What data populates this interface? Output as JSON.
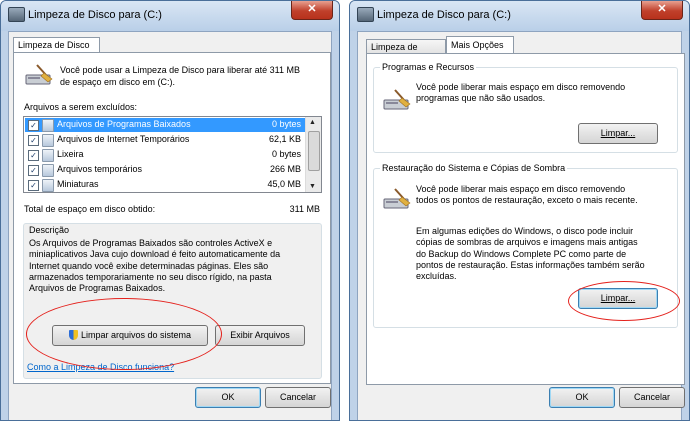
{
  "left": {
    "title": "Limpeza de Disco para  (C:)",
    "close_glyph": "✕",
    "tab": "Limpeza de Disco",
    "intro_line1": "Você pode usar a Limpeza de Disco para liberar até 311 MB",
    "intro_line2": "de espaço em disco em  (C:).",
    "list_label": "Arquivos a serem excluídos:",
    "files": [
      {
        "name": "Arquivos de Programas Baixados",
        "size": "0 bytes",
        "checked": true,
        "selected": true
      },
      {
        "name": "Arquivos de Internet Temporários",
        "size": "62,1 KB",
        "checked": true,
        "selected": false
      },
      {
        "name": "Lixeira",
        "size": "0 bytes",
        "checked": true,
        "selected": false
      },
      {
        "name": "Arquivos temporários",
        "size": "266 MB",
        "checked": true,
        "selected": false
      },
      {
        "name": "Miniaturas",
        "size": "45,0 MB",
        "checked": true,
        "selected": false
      }
    ],
    "total_label": "Total de espaço em disco obtido:",
    "total_value": "311 MB",
    "desc_label": "Descrição",
    "desc_text": "Os Arquivos de Programas Baixados são controles ActiveX e\nminiaplicativos Java cujo download é feito automaticamente da\nInternet quando você exibe determinadas páginas. Eles são\narmazenados temporariamente no seu disco rígido, na pasta\nArquivos de Programas Baixados.",
    "clean_system_button": "Limpar arquivos do sistema",
    "view_files_button": "Exibir Arquivos",
    "help_link": "Como a Limpeza de Disco funciona?",
    "ok_button": "OK",
    "cancel_button": "Cancelar"
  },
  "right": {
    "title": "Limpeza de Disco para  (C:)",
    "close_glyph": "✕",
    "tab1": "Limpeza de Disco",
    "tab2": "Mais Opções",
    "programs_group_label": "Programas e Recursos",
    "programs_text": "Você pode liberar mais espaço em disco removendo\nprogramas que não são usados.",
    "programs_button": "Limpar...",
    "restore_group_label": "Restauração do Sistema e Cópias de Sombra",
    "restore_text": "Você pode liberar mais espaço em disco removendo\ntodos os pontos de restauração, exceto o mais recente.",
    "restore_note": "Em algumas edições do Windows, o disco pode incluir\ncópias de sombras de arquivos e imagens mais antigas\ndo Backup do Windows Complete PC como parte de\npontos de restauração. Estas informações também serão\nexcluídas.",
    "restore_button": "Limpar...",
    "ok_button": "OK",
    "cancel_button": "Cancelar"
  },
  "colors": {
    "selection": "#3399ff",
    "annotation_ring": "#e4211c",
    "link": "#0066cc"
  }
}
